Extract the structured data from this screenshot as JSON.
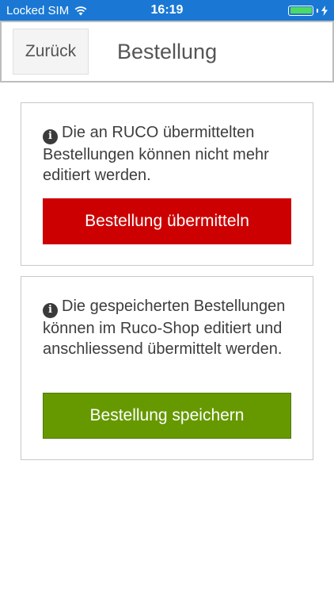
{
  "status_bar": {
    "carrier": "Locked SIM",
    "time": "16:19",
    "battery_level": 1.0,
    "icons": [
      "wifi-icon",
      "battery-icon",
      "charging-bolt-icon"
    ]
  },
  "header": {
    "back_label": "Zurück",
    "title": "Bestellung"
  },
  "cards": [
    {
      "info": "Die an RUCO übermittelten Bestellungen können nicht mehr editiert werden.",
      "button_label": "Bestellung übermitteln",
      "button_color": "#cc0000"
    },
    {
      "info": "Die gespeicherten Bestellungen können im Ruco-Shop editiert und anschliessend übermittelt werden.",
      "button_label": "Bestellung speichern",
      "button_color": "#669900"
    }
  ],
  "colors": {
    "status_bar_bg": "#1a78d4",
    "submit": "#cc0000",
    "save": "#669900",
    "battery": "#4cd964"
  }
}
